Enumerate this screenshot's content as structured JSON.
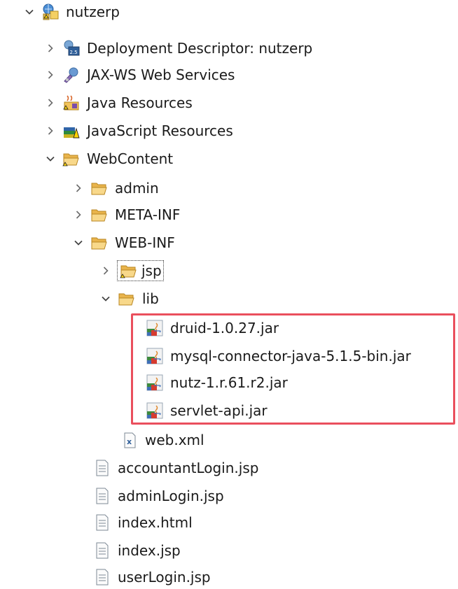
{
  "tree": {
    "project": {
      "label": "nutzerp",
      "icon": "web-project-icon",
      "expanded": true
    },
    "deployment_descriptor": {
      "label": "Deployment Descriptor: nutzerp",
      "icon": "deployment-descriptor-icon"
    },
    "jaxws": {
      "label": "JAX-WS Web Services",
      "icon": "web-services-icon"
    },
    "java_resources": {
      "label": "Java Resources",
      "icon": "java-resources-icon"
    },
    "javascript_resources": {
      "label": "JavaScript Resources",
      "icon": "javascript-resources-icon"
    },
    "webcontent": {
      "label": "WebContent",
      "icon": "folder-icon",
      "expanded": true
    },
    "admin": {
      "label": "admin",
      "icon": "folder-icon"
    },
    "meta_inf": {
      "label": "META-INF",
      "icon": "folder-icon"
    },
    "web_inf": {
      "label": "WEB-INF",
      "icon": "folder-icon",
      "expanded": true
    },
    "jsp": {
      "label": "jsp",
      "icon": "folder-icon",
      "focused": true
    },
    "lib": {
      "label": "lib",
      "icon": "folder-icon",
      "expanded": true
    },
    "jars": [
      {
        "label": "druid-1.0.27.jar",
        "icon": "jar-icon"
      },
      {
        "label": "mysql-connector-java-5.1.5-bin.jar",
        "icon": "jar-icon"
      },
      {
        "label": "nutz-1.r.61.r2.jar",
        "icon": "jar-icon"
      },
      {
        "label": "servlet-api.jar",
        "icon": "jar-icon"
      }
    ],
    "web_xml": {
      "label": "web.xml",
      "icon": "xml-file-icon"
    },
    "files": [
      {
        "label": "accountantLogin.jsp",
        "icon": "file-icon"
      },
      {
        "label": "adminLogin.jsp",
        "icon": "file-icon"
      },
      {
        "label": "index.html",
        "icon": "file-icon"
      },
      {
        "label": "index.jsp",
        "icon": "file-icon"
      },
      {
        "label": "userLogin.jsp",
        "icon": "file-icon"
      }
    ]
  },
  "colors": {
    "highlight_border": "#ea4f5d",
    "folder": "#f2c46b",
    "chevron": "#555555"
  }
}
